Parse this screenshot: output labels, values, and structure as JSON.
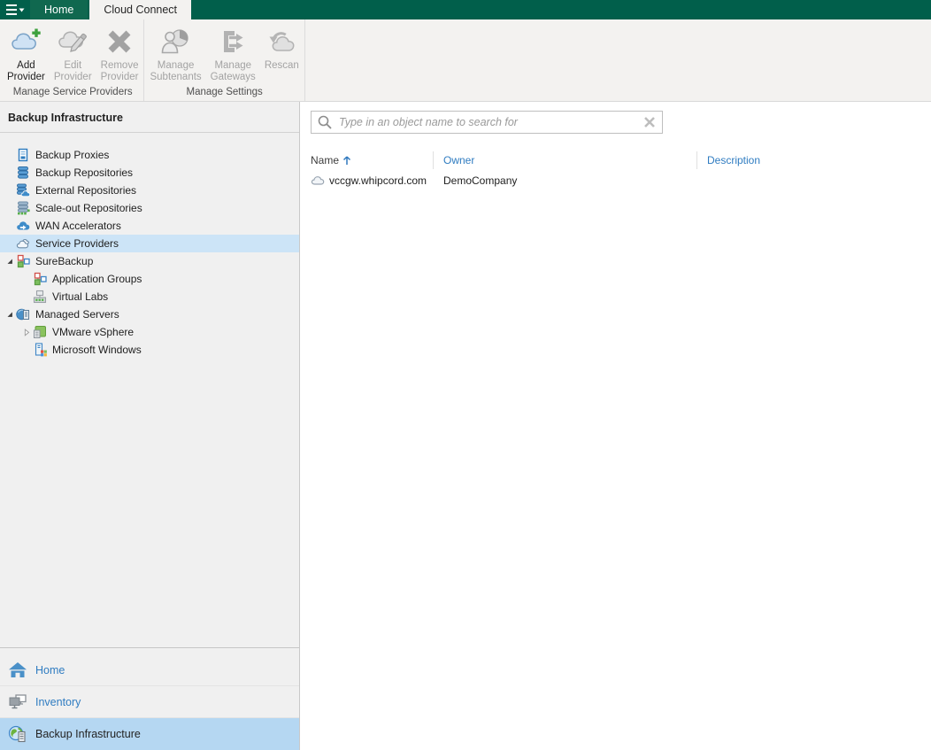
{
  "titlebar": {
    "menu_icon": "hamburger",
    "tabs": [
      {
        "label": "Home",
        "active": false
      },
      {
        "label": "Cloud Connect",
        "active": true
      }
    ]
  },
  "ribbon": {
    "groups": [
      {
        "label": "Manage Service Providers",
        "buttons": [
          {
            "label": "Add Provider",
            "lines": [
              "Add",
              "Provider"
            ],
            "icon": "add-provider",
            "enabled": true
          },
          {
            "label": "Edit Provider",
            "lines": [
              "Edit",
              "Provider"
            ],
            "icon": "edit-provider",
            "enabled": false
          },
          {
            "label": "Remove Provider",
            "lines": [
              "Remove",
              "Provider"
            ],
            "icon": "remove-provider",
            "enabled": false
          }
        ]
      },
      {
        "label": "Manage Settings",
        "buttons": [
          {
            "label": "Manage Subtenants",
            "lines": [
              "Manage",
              "Subtenants"
            ],
            "icon": "manage-subtenants",
            "enabled": false
          },
          {
            "label": "Manage Gateways",
            "lines": [
              "Manage",
              "Gateways"
            ],
            "icon": "manage-gateways",
            "enabled": false
          },
          {
            "label": "Rescan",
            "lines": [
              "Rescan"
            ],
            "icon": "rescan",
            "enabled": false
          }
        ]
      }
    ]
  },
  "sidebar": {
    "title": "Backup Infrastructure",
    "tree": [
      {
        "label": "Backup Proxies",
        "icon": "backup-proxies",
        "level": 0,
        "expander": "none",
        "selected": false
      },
      {
        "label": "Backup Repositories",
        "icon": "backup-repositories",
        "level": 0,
        "expander": "none",
        "selected": false
      },
      {
        "label": "External Repositories",
        "icon": "external-repositories",
        "level": 0,
        "expander": "none",
        "selected": false
      },
      {
        "label": "Scale-out Repositories",
        "icon": "scale-out-repositories",
        "level": 0,
        "expander": "none",
        "selected": false
      },
      {
        "label": "WAN Accelerators",
        "icon": "wan-accelerators",
        "level": 0,
        "expander": "none",
        "selected": false
      },
      {
        "label": "Service Providers",
        "icon": "service-providers",
        "level": 0,
        "expander": "none",
        "selected": true
      },
      {
        "label": "SureBackup",
        "icon": "surebackup",
        "level": 0,
        "expander": "expanded",
        "selected": false
      },
      {
        "label": "Application Groups",
        "icon": "application-groups",
        "level": 1,
        "expander": "none",
        "selected": false
      },
      {
        "label": "Virtual Labs",
        "icon": "virtual-labs",
        "level": 1,
        "expander": "none",
        "selected": false
      },
      {
        "label": "Managed Servers",
        "icon": "managed-servers",
        "level": 0,
        "expander": "expanded",
        "selected": false
      },
      {
        "label": "VMware vSphere",
        "icon": "vmware-vsphere",
        "level": 1,
        "expander": "collapsed",
        "selected": false
      },
      {
        "label": "Microsoft Windows",
        "icon": "microsoft-windows",
        "level": 1,
        "expander": "none",
        "selected": false
      }
    ],
    "nav": [
      {
        "label": "Home",
        "icon": "nav-home",
        "selected": false
      },
      {
        "label": "Inventory",
        "icon": "nav-inventory",
        "selected": false
      },
      {
        "label": "Backup Infrastructure",
        "icon": "nav-backup-infrastructure",
        "selected": true
      }
    ]
  },
  "main": {
    "search": {
      "placeholder": "Type in an object name to search for",
      "value": "",
      "icon": "search",
      "clear_icon": "clear"
    },
    "table": {
      "columns": [
        {
          "label": "Name",
          "sorted": "asc"
        },
        {
          "label": "Owner",
          "sorted": null
        },
        {
          "label": "Description",
          "sorted": null
        }
      ],
      "rows": [
        {
          "icon": "row-cloud",
          "name": "vccgw.whipcord.com",
          "owner": "DemoCompany",
          "description": ""
        }
      ]
    }
  },
  "colors": {
    "titlebar_green": "#015f4b",
    "home_tab_green": "#10684f",
    "active_tab_bg": "#f3f2f0",
    "tree_selection_blue": "#cce4f7",
    "nav_selection_blue": "#b5d7f2",
    "link_blue": "#2f7cc1",
    "add_icon_green": "#3ea13e"
  }
}
